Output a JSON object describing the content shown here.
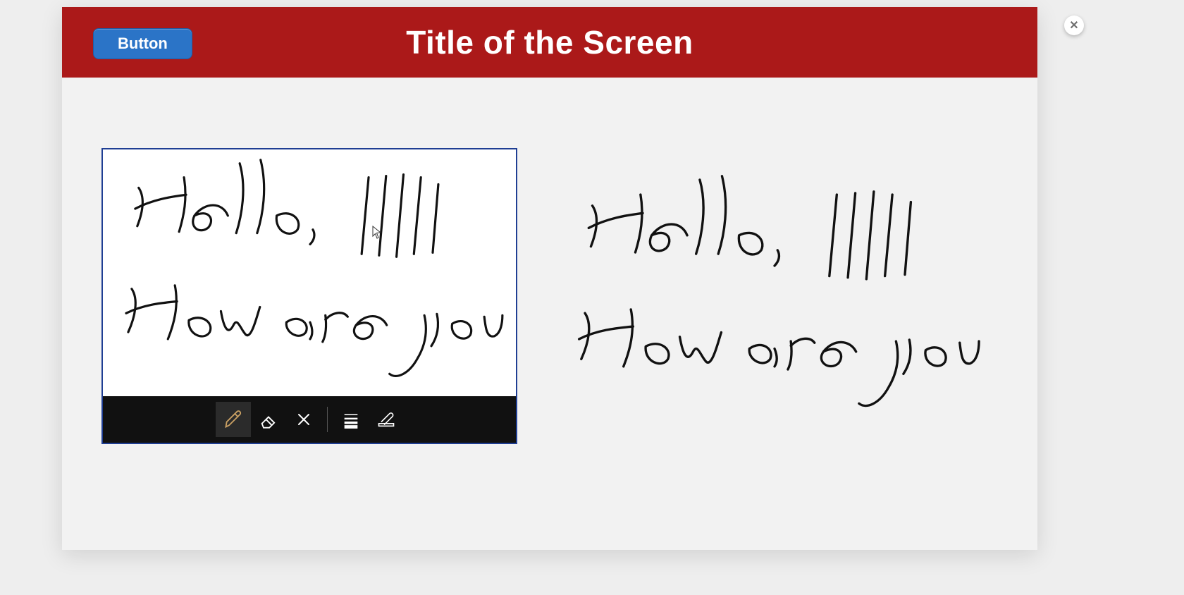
{
  "header": {
    "title": "Title of the Screen",
    "button_label": "Button"
  },
  "close": {
    "glyph": "✕",
    "name": "close"
  },
  "signature_pad": {
    "handwriting_line1": "Hello,",
    "handwriting_tally": "|||||",
    "handwriting_line2": "How are you",
    "toolbar": {
      "pen": "pen",
      "eraser": "eraser",
      "clear": "clear",
      "lines": "line-weight",
      "edit": "edit-text",
      "selected": "pen"
    }
  },
  "preview": {
    "mirror_of": "signature_pad"
  },
  "colors": {
    "header_bg": "#ab1919",
    "button_bg": "#2b74c7",
    "pad_border": "#1f3e93",
    "toolbar_bg": "#111111",
    "pen_selected": "#c9a063"
  }
}
